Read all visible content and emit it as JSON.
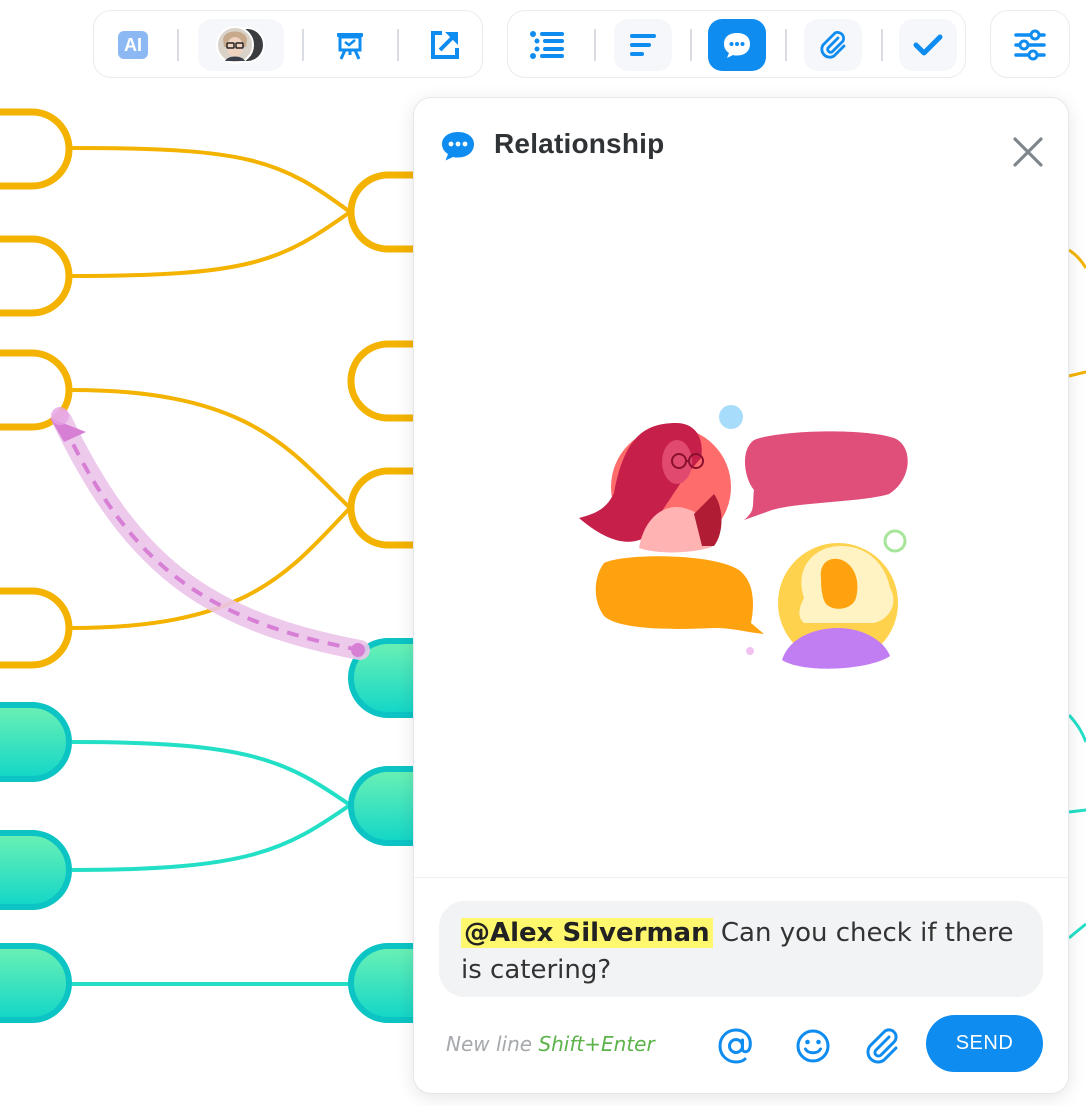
{
  "toolbar": {
    "groups": [
      {
        "items": [
          "ai-button",
          "collaborators-avatars",
          "presentation-button",
          "export-button"
        ]
      },
      {
        "items": [
          "outline-button",
          "notes-button",
          "comments-button",
          "attachments-button",
          "tasks-button"
        ]
      },
      {
        "items": [
          "settings-button"
        ]
      }
    ],
    "ai_label": "AI",
    "active": "comments"
  },
  "panel": {
    "title": "Relationship",
    "message": {
      "mention": "@Alex Silverman",
      "text": " Can you check if there is catering?"
    },
    "hint": {
      "prefix": "New line ",
      "shortcut": "Shift+Enter"
    },
    "send_label": "SEND"
  },
  "icons": {
    "ai": "ai-badge-icon",
    "presentation": "presentation-icon",
    "export": "external-link-icon",
    "outline": "list-icon",
    "notes": "text-lines-icon",
    "comments": "chat-bubble-icon",
    "attachments": "paperclip-icon",
    "tasks": "checkmark-icon",
    "settings": "sliders-icon",
    "close": "close-icon",
    "mention": "at-icon",
    "emoji": "smiley-icon",
    "attach": "paperclip-icon"
  },
  "colors": {
    "accent": "#0f8cf0",
    "branch_yellow": "#f3b300",
    "branch_teal": "#12c8c0",
    "relationship": "#e3b0e0",
    "mention_highlight": "#fff86e"
  }
}
